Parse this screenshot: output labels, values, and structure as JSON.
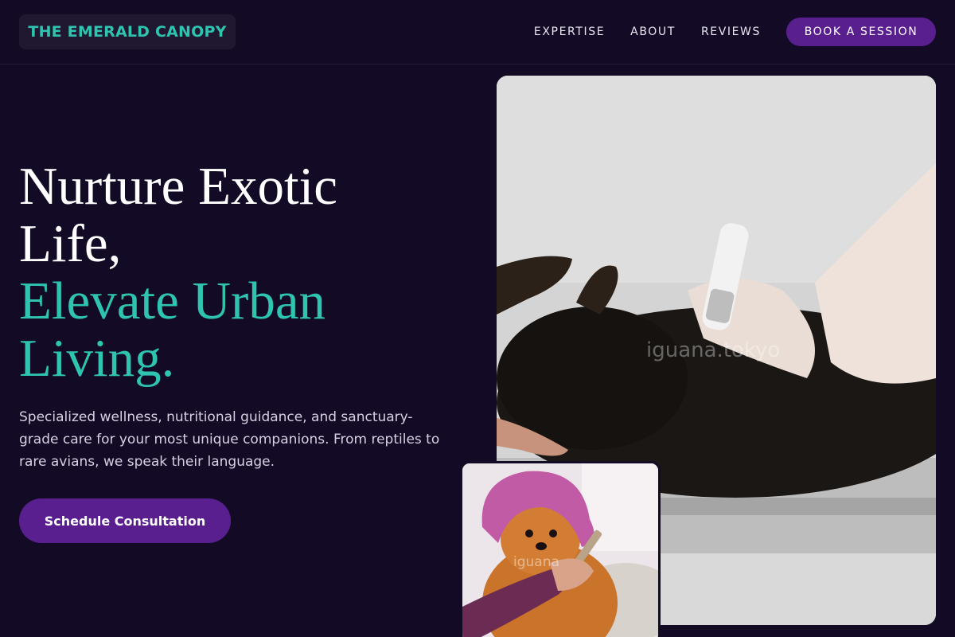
{
  "brand": {
    "name": "THE EMERALD CANOPY"
  },
  "nav": {
    "links": [
      "EXPERTISE",
      "ABOUT",
      "REVIEWS"
    ],
    "cta": "BOOK A SESSION"
  },
  "hero": {
    "title_lines": [
      "Nurture Exotic",
      "Life,"
    ],
    "accent_lines": [
      "Elevate Urban",
      "Living."
    ],
    "description": "Specialized wellness, nutritional guidance, and sanctuary-grade care for your most unique companions. From reptiles to rare avians, we speak their language.",
    "cta": "Schedule Consultation"
  },
  "images": {
    "main_watermark": "iguana.tokyo",
    "small_watermark": "iguana"
  },
  "colors": {
    "background": "#130b25",
    "accent_teal": "#2ec4b0",
    "accent_purple": "#5a1f8e"
  }
}
